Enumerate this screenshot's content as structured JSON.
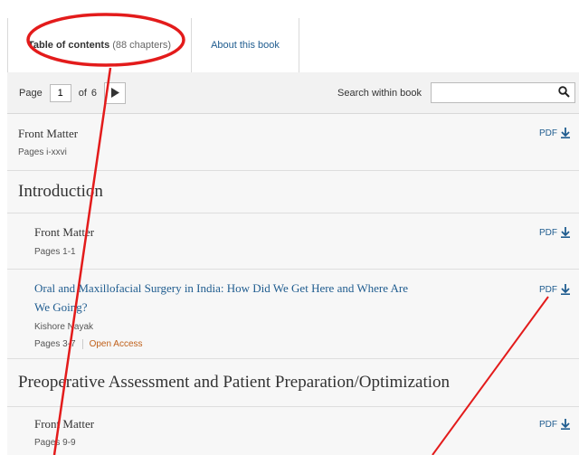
{
  "tabs": {
    "toc_label": "Table of contents",
    "toc_count": "(88 chapters)",
    "about_label": "About this book"
  },
  "pager": {
    "page_label": "Page",
    "page_value": "1",
    "of_label": "of",
    "total_pages": "6",
    "search_label": "Search within book",
    "search_value": ""
  },
  "entries": [
    {
      "title": "Front Matter",
      "pages": "Pages i-xxvi",
      "pdf": "PDF"
    }
  ],
  "sections": [
    {
      "heading": "Introduction",
      "items": [
        {
          "title": "Front Matter",
          "pages": "Pages 1-1",
          "pdf": "PDF"
        },
        {
          "title_line1": "Oral and Maxillofacial Surgery in India: How Did We Get Here and Where Are",
          "title_line2": "We Going?",
          "author": "Kishore Nayak",
          "pages": "Pages 3-7",
          "access": "Open Access",
          "pdf": "PDF"
        }
      ]
    },
    {
      "heading": "Preoperative Assessment and Patient Preparation/Optimization",
      "items": [
        {
          "title": "Front Matter",
          "pages": "Pages 9-9",
          "pdf": "PDF"
        }
      ]
    }
  ],
  "colors": {
    "link": "#1f5c8f",
    "open_access": "#c0601a",
    "annotation": "#e31b1b"
  },
  "icons": {
    "next": "play-triangle-icon",
    "search": "magnifier-icon",
    "download": "download-arrow-icon"
  }
}
